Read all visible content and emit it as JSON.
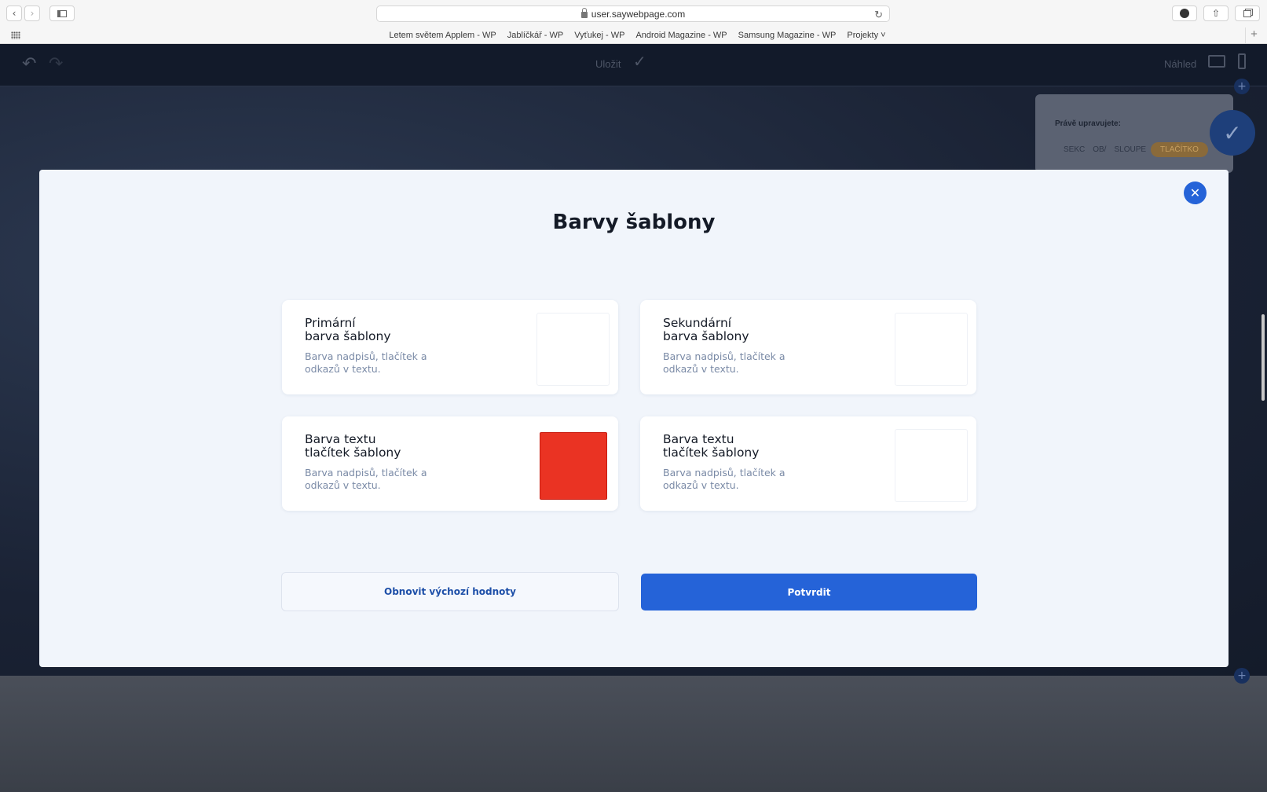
{
  "browser": {
    "url": "user.saywebpage.com",
    "bookmarks": [
      "Letem světem Applem - WP",
      "Jablíčkář - WP",
      "Vyťukej - WP",
      "Android Magazine - WP",
      "Samsung Magazine - WP",
      "Projekty"
    ]
  },
  "editor": {
    "save_label": "Uložit",
    "preview_label": "Náhled",
    "editing_label": "Právě upravujete:",
    "tabs": [
      "SEKC",
      "OB/",
      "SLOUPE",
      "TLAČÍTKO"
    ]
  },
  "modal": {
    "title": "Barvy šablony",
    "cards": [
      {
        "title_line1": "Primární",
        "title_line2": "barva šablony",
        "desc": "Barva nadpisů, tlačítek a odkazů v textu.",
        "color": "#ffffff"
      },
      {
        "title_line1": "Sekundární",
        "title_line2": "barva šablony",
        "desc": "Barva nadpisů, tlačítek a odkazů v textu.",
        "color": "#ffffff"
      },
      {
        "title_line1": "Barva textu",
        "title_line2": "tlačítek šablony",
        "desc": "Barva nadpisů, tlačítek a odkazů v textu.",
        "color": "#ea3323"
      },
      {
        "title_line1": "Barva textu",
        "title_line2": "tlačítek šablony",
        "desc": "Barva nadpisů, tlačítek a odkazů v textu.",
        "color": "#ffffff"
      }
    ],
    "reset_label": "Obnovit výchozí hodnoty",
    "confirm_label": "Potvrdit"
  },
  "colors": {
    "accent": "#2563d8",
    "modal_bg": "#f1f5fb"
  }
}
